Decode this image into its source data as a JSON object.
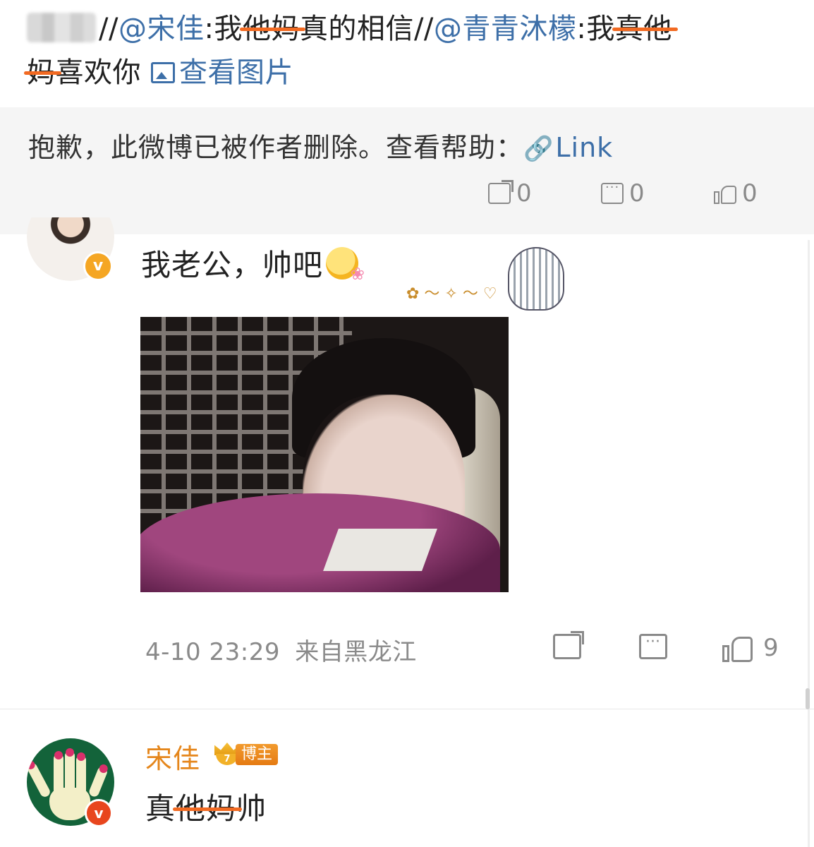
{
  "repost": {
    "separator1": "//",
    "mention1": "@宋佳",
    "colon1": ":我",
    "strike1": "他妈",
    "text1": "真的相信",
    "separator2": "//",
    "mention2": "@青青沐檬",
    "colon2": ":我",
    "strike2": "真他",
    "strike3": "妈",
    "text2": "喜欢你",
    "view_picture": "查看图片"
  },
  "deleted_notice": {
    "text": "抱歉，此微博已被作者删除。查看帮助：",
    "link_icon": "🔗",
    "link_label": "Link",
    "share_count": "0",
    "comment_count": "0",
    "like_count": "0"
  },
  "comment1": {
    "verified_mark": "v",
    "text": "我老公，帅吧",
    "timestamp": "4-10 23:29",
    "location": "来自黑龙江",
    "like_count": "9"
  },
  "comment2": {
    "author": "宋佳",
    "crown_level": "7",
    "badge": "博主",
    "verified_mark": "v",
    "text_prefix": "真",
    "strike": "他妈",
    "text_suffix": "帅"
  },
  "colors": {
    "mention": "#3d6fa8",
    "strike": "#f26a22",
    "author": "#e5861b",
    "muted": "#8a8a8a"
  }
}
